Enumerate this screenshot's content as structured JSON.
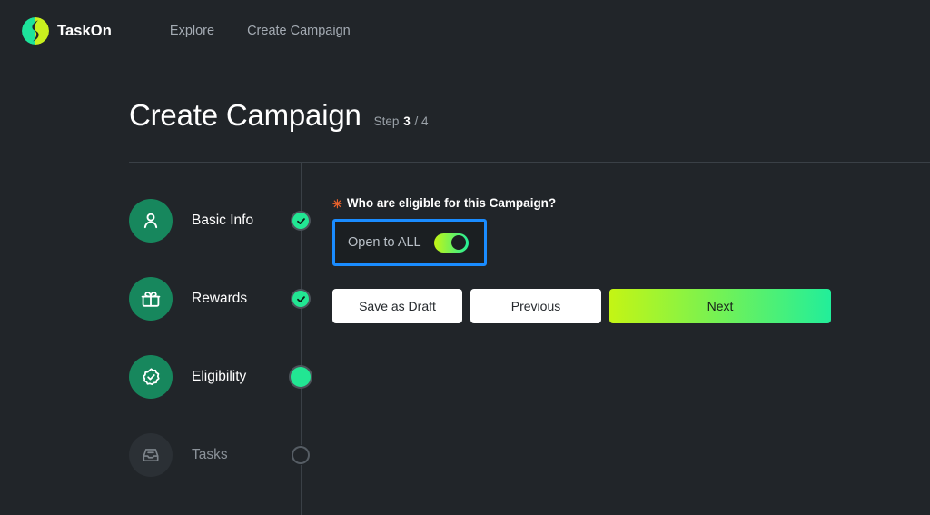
{
  "brand": {
    "name": "TaskOn",
    "logo_icon": "taskon-lightning-logo",
    "logo_colors": {
      "left": "#1de39b",
      "right": "#c9f01e"
    }
  },
  "nav": {
    "links": [
      {
        "label": "Explore",
        "name": "nav-link-explore"
      },
      {
        "label": "Create Campaign",
        "name": "nav-link-create-campaign"
      }
    ]
  },
  "page": {
    "title": "Create Campaign",
    "step_word": "Step",
    "step_current": "3",
    "step_total": "/ 4"
  },
  "stepper": {
    "steps": [
      {
        "label": "Basic Info",
        "icon": "user-icon",
        "state": "completed",
        "marker": "check-badge-icon"
      },
      {
        "label": "Rewards",
        "icon": "gift-icon",
        "state": "completed",
        "marker": "check-badge-icon"
      },
      {
        "label": "Eligibility",
        "icon": "verified-badge-icon",
        "state": "current",
        "marker": "current-dot"
      },
      {
        "label": "Tasks",
        "icon": "inbox-tray-icon",
        "state": "pending",
        "marker": "empty-circle"
      }
    ]
  },
  "form": {
    "required_mark": "✳",
    "question_label": "Who are eligible for this Campaign?",
    "eligibility": {
      "option_label": "Open to ALL",
      "toggle_on": true
    }
  },
  "actions": {
    "save_draft_label": "Save as Draft",
    "previous_label": "Previous",
    "next_label": "Next"
  },
  "colors": {
    "background": "#212529",
    "accent_green": "#22e693",
    "accent_lime": "#c4f514",
    "focus_blue": "#1a8cff",
    "required_orange": "#e8622c",
    "step_circle_green": "#17875d",
    "divider": "#3a4046"
  }
}
